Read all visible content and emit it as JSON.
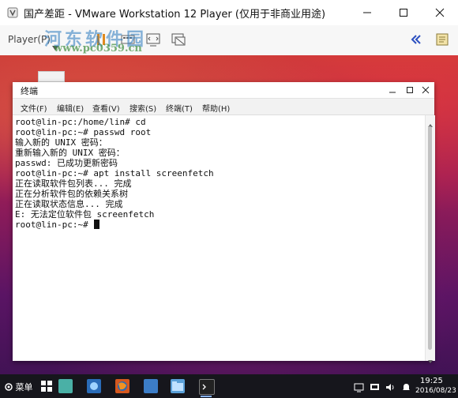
{
  "vmware": {
    "title": "国产差距 - VMware Workstation 12 Player (仅用于非商业用途)",
    "player_menu": "Player(P)",
    "icons": [
      "vmware-app-icon",
      "power-pause-icon",
      "send-ctrl-alt-del-icon",
      "fit-guest-icon",
      "unity-mode-icon",
      "collapse-toolbar-icon",
      "vm-message-icon"
    ],
    "watermark": {
      "line1": "河东软件园",
      "line2": "www.pc0359.cn"
    }
  },
  "terminal": {
    "title": "终端",
    "menu": [
      "文件(F)",
      "编辑(E)",
      "查看(V)",
      "搜索(S)",
      "终端(T)",
      "帮助(H)"
    ],
    "lines": [
      "root@lin-pc:/home/lin# cd",
      "root@lin-pc:~# passwd root",
      "输入新的 UNIX 密码：",
      "重新输入新的 UNIX 密码：",
      "passwd: 已成功更新密码",
      "root@lin-pc:~# apt install screenfetch",
      "正在读取软件包列表... 完成",
      "正在分析软件包的依赖关系树",
      "正在读取状态信息... 完成",
      "E: 无法定位软件包 screenfetch",
      "root@lin-pc:~# "
    ]
  },
  "taskbar": {
    "start_label": "菜单",
    "apps": [
      "show-desktop-icon",
      "file-manager-icon",
      "store-icon",
      "firefox-icon",
      "folder-icon",
      "terminal-app-icon"
    ],
    "tray": [
      "network-icon",
      "volume-icon",
      "notification-icon"
    ],
    "time": "19:25",
    "date": "2016/08/23"
  },
  "colors": {
    "taskbar_bg": "#16161c",
    "desktop_top": "#c93a3a",
    "desktop_bottom": "#3a1250"
  }
}
